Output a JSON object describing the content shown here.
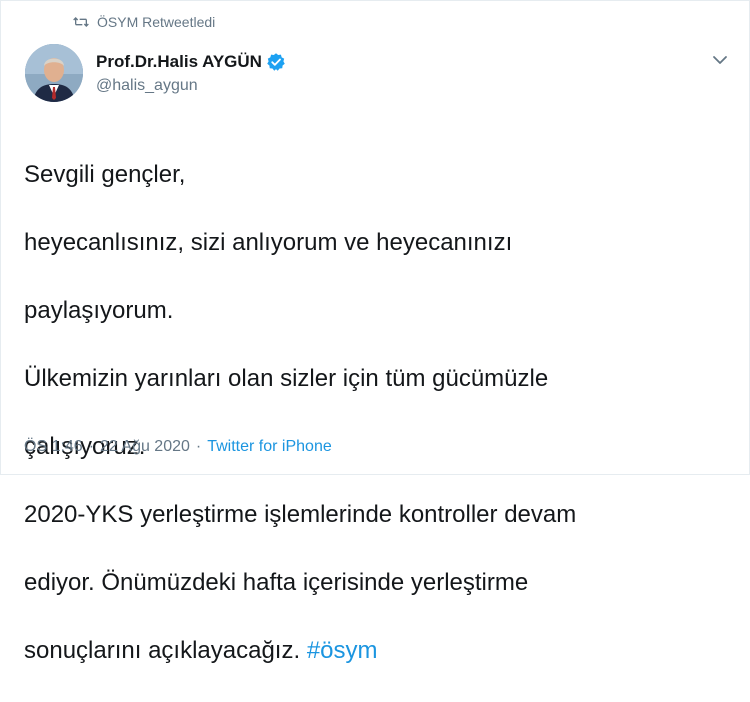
{
  "retweet_context": {
    "label": "ÖSYM Retweetledi",
    "icon": "retweet-icon"
  },
  "author": {
    "display_name": "Prof.Dr.Halis AYGÜN",
    "handle": "@halis_aygun",
    "verified": true,
    "verified_icon": "verified-badge-icon"
  },
  "menu_icon": "chevron-down-icon",
  "tweet": {
    "lines": [
      "Sevgili gençler,",
      "heyecanlısınız, sizi anlıyorum ve heyecanınızı",
      "paylaşıyorum.",
      "Ülkemizin yarınları olan sizler için tüm gücümüzle",
      "çalışıyoruz.",
      "2020-YKS yerleştirme işlemlerinde kontroller devam",
      "ediyor. Önümüzdeki hafta içerisinde yerleştirme",
      "sonuçlarını açıklayacağız."
    ],
    "hashtag": "#ösym"
  },
  "meta": {
    "time": "ÖS 1:46",
    "separator": "·",
    "date": "22 Ağu 2020",
    "source": "Twitter for iPhone"
  },
  "colors": {
    "link": "#1b95e0",
    "secondary_text": "#657786",
    "primary_text": "#14171a",
    "verified": "#1da1f2"
  }
}
